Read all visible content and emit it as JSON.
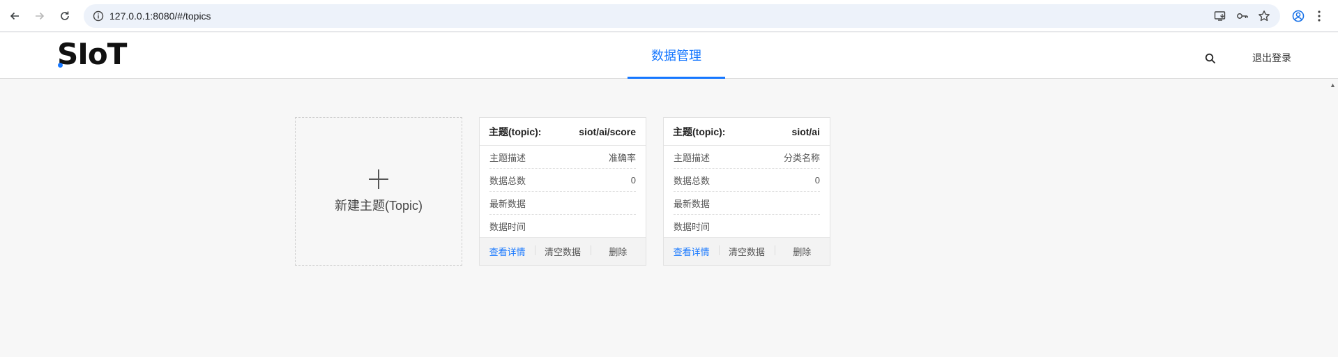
{
  "browser": {
    "url": "127.0.0.1:8080/#/topics"
  },
  "header": {
    "logo": "SIoT",
    "nav_tab": "数据管理",
    "logout": "退出登录"
  },
  "new_topic": {
    "label": "新建主题(Topic)"
  },
  "topics": [
    {
      "title_label": "主题(topic):",
      "topic": "siot/ai/score",
      "rows": [
        {
          "label": "主题描述",
          "value": "准确率"
        },
        {
          "label": "数据总数",
          "value": "0"
        },
        {
          "label": "最新数据",
          "value": ""
        },
        {
          "label": "数据时间",
          "value": ""
        }
      ],
      "actions": {
        "view": "查看详情",
        "clear": "清空数据",
        "delete": "删除"
      }
    },
    {
      "title_label": "主题(topic):",
      "topic": "siot/ai",
      "rows": [
        {
          "label": "主题描述",
          "value": "分类名称"
        },
        {
          "label": "数据总数",
          "value": "0"
        },
        {
          "label": "最新数据",
          "value": ""
        },
        {
          "label": "数据时间",
          "value": ""
        }
      ],
      "actions": {
        "view": "查看详情",
        "clear": "清空数据",
        "delete": "删除"
      }
    }
  ],
  "colors": {
    "accent": "#1677ff",
    "page_bg": "#f7f7f7"
  }
}
